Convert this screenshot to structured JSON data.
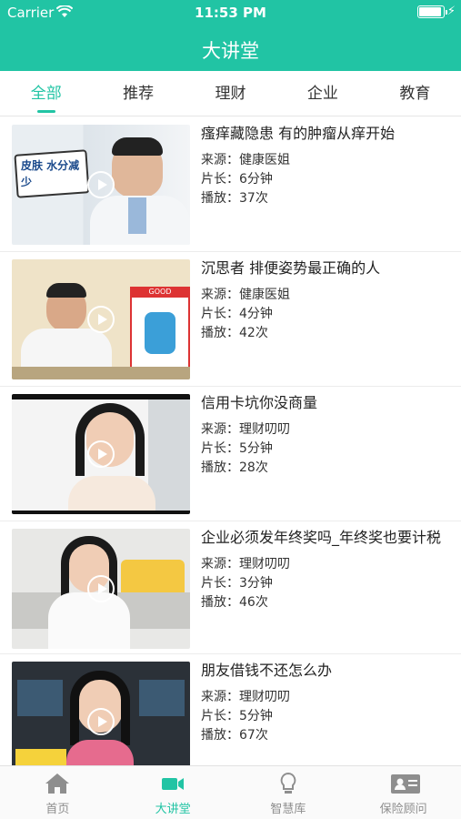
{
  "status_bar": {
    "carrier": "Carrier",
    "time": "11:53 PM"
  },
  "header": {
    "title": "大讲堂"
  },
  "tabs": [
    {
      "label": "全部",
      "active": true
    },
    {
      "label": "推荐",
      "active": false
    },
    {
      "label": "理财",
      "active": false
    },
    {
      "label": "企业",
      "active": false
    },
    {
      "label": "教育",
      "active": false
    }
  ],
  "videos": [
    {
      "title": "瘙痒藏隐患 有的肿瘤从痒开始",
      "source": "来源：健康医姐",
      "duration": "片长：6分钟",
      "plays": "播放：37次",
      "thumb_text": "皮肤 水分减少"
    },
    {
      "title": "沉思者 排便姿势最正确的人",
      "source": "来源：健康医姐",
      "duration": "片长：4分钟",
      "plays": "播放：42次",
      "thumb_text": "GOOD"
    },
    {
      "title": "信用卡坑你没商量",
      "source": "来源：理财叨叨",
      "duration": "片长：5分钟",
      "plays": "播放：28次",
      "thumb_text": ""
    },
    {
      "title": "企业必须发年终奖吗_年终奖也要计税",
      "source": "来源：理财叨叨",
      "duration": "片长：3分钟",
      "plays": "播放：46次",
      "thumb_text": ""
    },
    {
      "title": "朋友借钱不还怎么办",
      "source": "来源：理财叨叨",
      "duration": "片长：5分钟",
      "plays": "播放：67次",
      "thumb_text": ""
    }
  ],
  "tabbar": [
    {
      "label": "首页",
      "icon": "home-icon",
      "active": false
    },
    {
      "label": "大讲堂",
      "icon": "video-camera-icon",
      "active": true
    },
    {
      "label": "智慧库",
      "icon": "lightbulb-icon",
      "active": false
    },
    {
      "label": "保险顾问",
      "icon": "contact-card-icon",
      "active": false
    }
  ],
  "colors": {
    "accent": "#21c4a4",
    "text": "#222222",
    "inactive": "#8e8e8e"
  }
}
